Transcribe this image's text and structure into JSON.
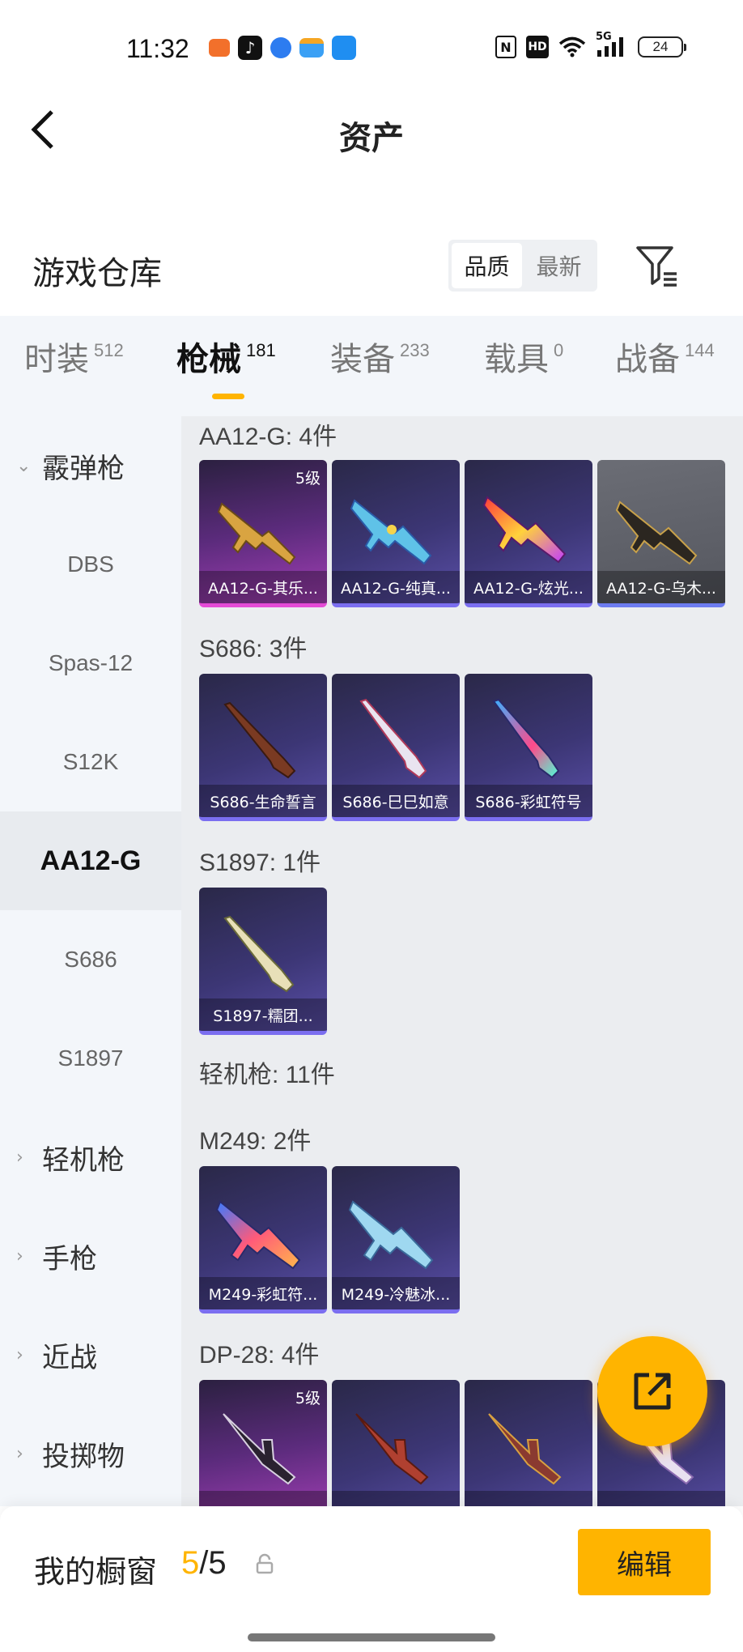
{
  "status_bar": {
    "time": "11:32",
    "apps": [
      {
        "icon": "game-app-icon",
        "color": "#f2702b"
      },
      {
        "icon": "tiktok-app-icon",
        "color": "#111111"
      },
      {
        "icon": "browser-app-icon",
        "color": "#2d7cf0"
      },
      {
        "icon": "wallet-app-icon",
        "color": "#3aa0f5"
      },
      {
        "icon": "messenger-app-icon",
        "color": "#1f8ef1"
      }
    ],
    "icons": [
      "nfc-icon",
      "hd-icon",
      "wifi-icon",
      "signal-5g-icon"
    ],
    "hd_label": "HD",
    "network_label": "5G",
    "battery": "24"
  },
  "header": {
    "title": "资产"
  },
  "warehouse": {
    "title": "游戏仓库",
    "sort_options": [
      "品质",
      "最新"
    ],
    "active_sort": 0
  },
  "tabs": [
    {
      "label": "时装",
      "count": "512"
    },
    {
      "label": "枪械",
      "count": "181"
    },
    {
      "label": "装备",
      "count": "233"
    },
    {
      "label": "载具",
      "count": "0"
    },
    {
      "label": "战备",
      "count": "144"
    }
  ],
  "sidebar": {
    "categories": [
      {
        "label": "霰弹枪",
        "expanded": true,
        "chevron": "chevron-down-icon"
      },
      {
        "label": "轻机枪",
        "expanded": false,
        "chevron": "chevron-right-icon"
      },
      {
        "label": "手枪",
        "expanded": false,
        "chevron": "chevron-right-icon"
      },
      {
        "label": "近战",
        "expanded": false,
        "chevron": "chevron-right-icon"
      },
      {
        "label": "投掷物",
        "expanded": false,
        "chevron": "chevron-right-icon"
      }
    ],
    "sub_items": [
      "DBS",
      "Spas-12",
      "S12K",
      "AA12-G",
      "S686",
      "S1897"
    ],
    "active_sub": "AA12-G"
  },
  "content": {
    "groups": [
      {
        "title": "AA12-G: 4件",
        "items": [
          {
            "name": "AA12-G-其乐...",
            "level": "5级",
            "rarity": "gold"
          },
          {
            "name": "AA12-G-纯真...",
            "level": "",
            "rarity": "purple"
          },
          {
            "name": "AA12-G-炫光...",
            "level": "",
            "rarity": "purple"
          },
          {
            "name": "AA12-G-乌木...",
            "level": "",
            "rarity": "grey"
          }
        ]
      },
      {
        "title": "S686: 3件",
        "items": [
          {
            "name": "S686-生命誓言",
            "level": "",
            "rarity": "purple"
          },
          {
            "name": "S686-巳巳如意",
            "level": "",
            "rarity": "purple"
          },
          {
            "name": "S686-彩虹符号",
            "level": "",
            "rarity": "purple"
          }
        ]
      },
      {
        "title": "S1897: 1件",
        "items": [
          {
            "name": "S1897-糯团...",
            "level": "",
            "rarity": "purple"
          }
        ]
      },
      {
        "title": "轻机枪: 11件",
        "items": []
      },
      {
        "title": "M249: 2件",
        "items": [
          {
            "name": "M249-彩虹符...",
            "level": "",
            "rarity": "purple"
          },
          {
            "name": "M249-冷魅冰...",
            "level": "",
            "rarity": "purple"
          }
        ]
      },
      {
        "title": "DP-28: 4件",
        "items": [
          {
            "name": "",
            "level": "5级",
            "rarity": "gold"
          },
          {
            "name": "",
            "level": "",
            "rarity": "purple"
          },
          {
            "name": "",
            "level": "",
            "rarity": "purple"
          },
          {
            "name": "",
            "level": "",
            "rarity": "purple"
          }
        ]
      }
    ]
  },
  "bottom_bar": {
    "title": "我的橱窗",
    "showcase_current": "5",
    "separator": "/",
    "showcase_max": "5",
    "edit_label": "编辑"
  },
  "colors": {
    "accent": "#ffb400",
    "gold_rarity": "#e44bd6",
    "purple_rarity": "#7b6ef0"
  }
}
